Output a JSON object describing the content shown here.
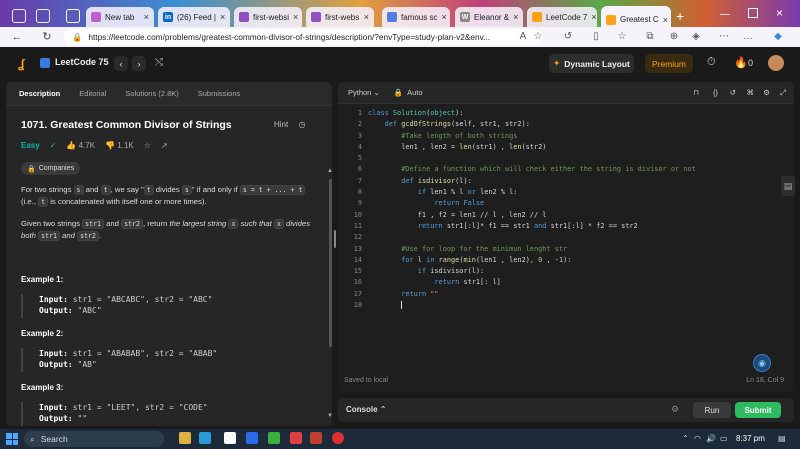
{
  "browser": {
    "tabs": [
      {
        "label": "New tab",
        "icon_color": "#c060d0"
      },
      {
        "label": "(26) Feed |",
        "icon_color": "#0a66c2"
      },
      {
        "label": "first-websi",
        "icon_color": "#9050c0"
      },
      {
        "label": "first-webs",
        "icon_color": "#9050c0"
      },
      {
        "label": "famous sc",
        "icon_color": "#5080e0"
      },
      {
        "label": "Eleanor &",
        "icon_color": "#888888"
      },
      {
        "label": "LeetCode 7",
        "icon_color": "#ffa116"
      },
      {
        "label": "Greatest C",
        "icon_color": "#ffa116"
      }
    ],
    "url": "https://leetcode.com/problems/greatest-common-divisor-of-strings/description/?envType=study-plan-v2&env..."
  },
  "header": {
    "study_plan": "LeetCode 75",
    "dynamic_layout": "Dynamic Layout",
    "premium": "Premium",
    "streak": "0",
    "accent": "#ffa116"
  },
  "left": {
    "tabs": [
      "Description",
      "Editorial",
      "Solutions (2.8K)",
      "Submissions"
    ],
    "title": "1071. Greatest Common Divisor of Strings",
    "hint": "Hint",
    "difficulty": "Easy",
    "likes": "4.7K",
    "dislikes": "1.1K",
    "companies": "Companies",
    "p1": {
      "a": "For two strings ",
      "s": "s",
      "b": " and ",
      "t": "t",
      "c": ", we say \"",
      "t2": "t",
      "d": " divides ",
      "s2": "s",
      "e": "\" if and only if ",
      "expr": "s = t + ... + t",
      "f": " (i.e., ",
      "t3": "t",
      "g": " is concatenated with itself one or more times)."
    },
    "p2": {
      "a": "Given two strings ",
      "s1": "str1",
      "b": " and ",
      "s2": "str2",
      "c": ", return ",
      "em": "the largest string ",
      "x": "x",
      "em2": " such that ",
      "x2": "x",
      "em3": " divides both ",
      "s3": "str1",
      "em4": " and ",
      "s4": "str2",
      "d": "."
    },
    "examples": [
      {
        "title": "Example 1:",
        "input": "str1 = \"ABCABC\", str2 = \"ABC\"",
        "output": "\"ABC\""
      },
      {
        "title": "Example 2:",
        "input": "str1 = \"ABABAB\", str2 = \"ABAB\"",
        "output": "\"AB\""
      },
      {
        "title": "Example 3:",
        "input": "str1 = \"LEET\", str2 = \"CODE\"",
        "output": "\"\""
      }
    ],
    "input_label": "Input:",
    "output_label": "Output:"
  },
  "editor": {
    "language": "Python",
    "mode": "Auto",
    "saved": "Saved to local",
    "position": "Ln 18, Col 9"
  },
  "console": {
    "label": "Console",
    "run": "Run",
    "submit": "Submit",
    "submit_color": "#2cbb5d"
  },
  "taskbar": {
    "search": "Search",
    "time": "8:37 pm"
  }
}
